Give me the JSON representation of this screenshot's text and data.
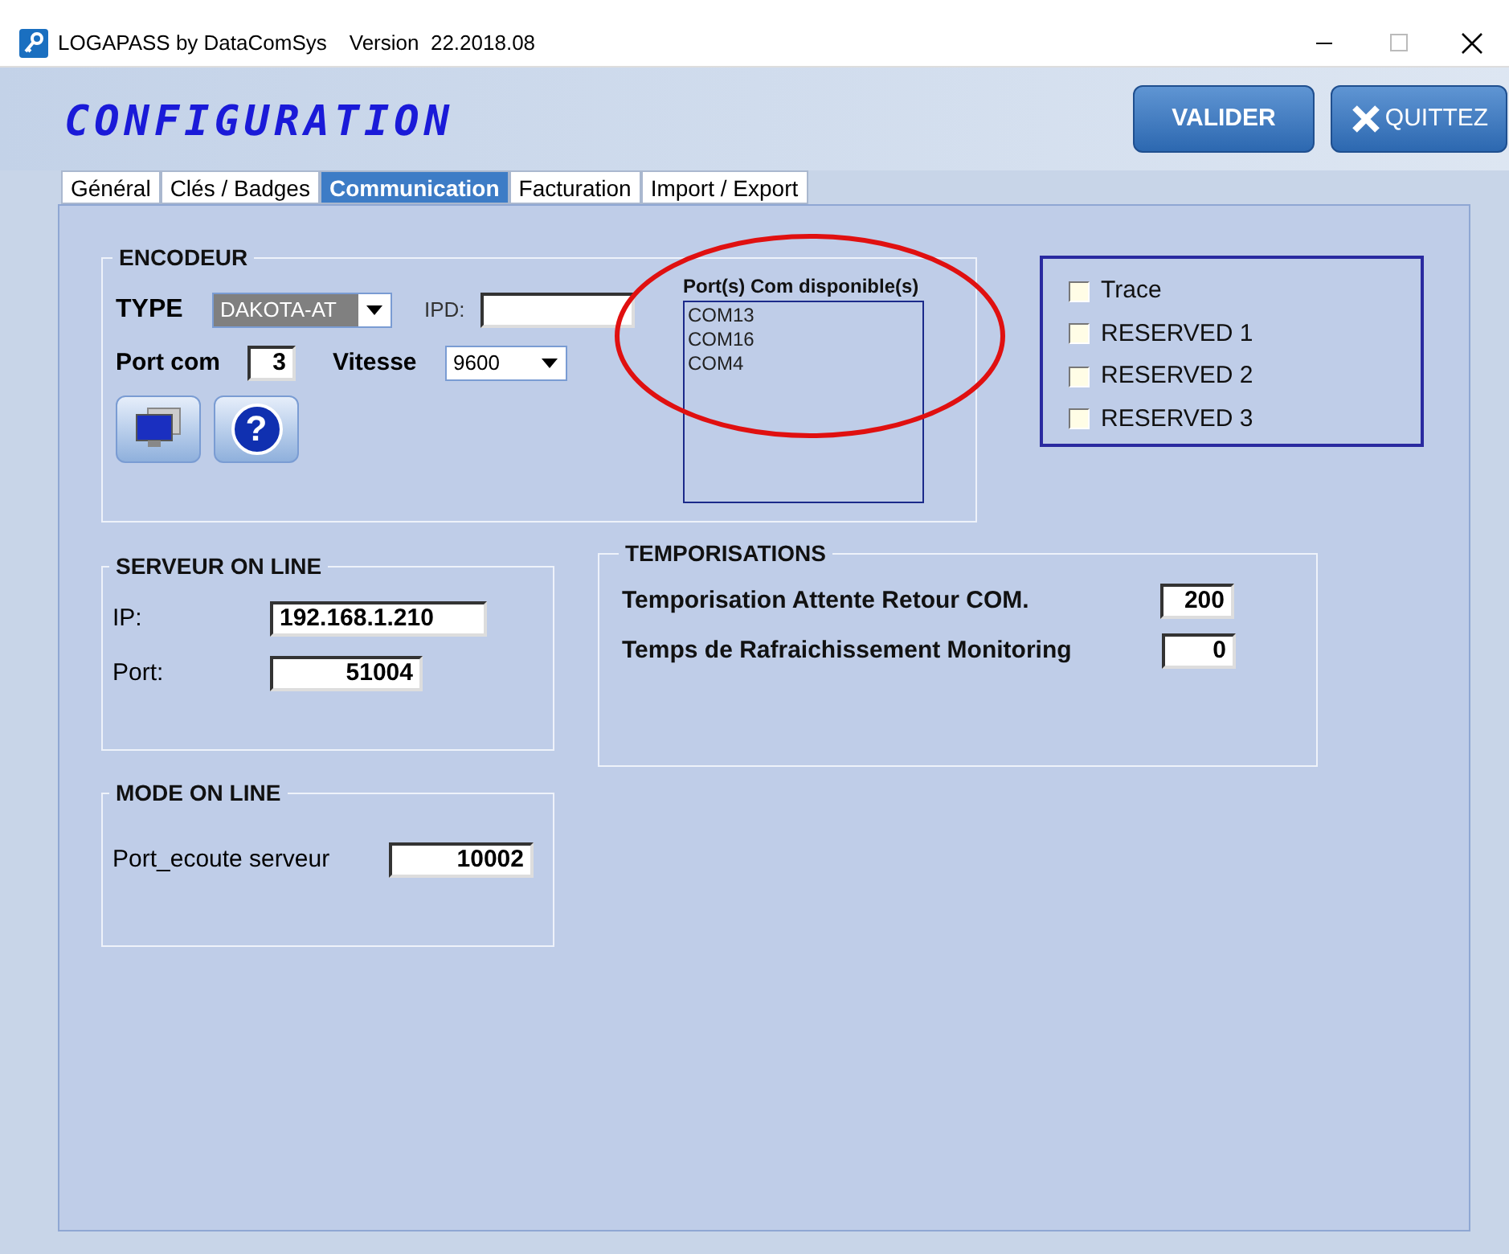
{
  "window": {
    "title": "LOGAPASS by DataComSys",
    "version": "Version  22.2018.08"
  },
  "header": {
    "title": "CONFIGURATION",
    "buttons": [
      {
        "label": "VALIDER",
        "kind": "plain"
      },
      {
        "label": "QUITTEZ",
        "kind": "close"
      }
    ]
  },
  "tabs": [
    {
      "label": "Général",
      "selected": false
    },
    {
      "label": "Clés / Badges",
      "selected": false
    },
    {
      "label": "Communication",
      "selected": true
    },
    {
      "label": "Facturation",
      "selected": false
    },
    {
      "label": "Import / Export",
      "selected": false
    }
  ],
  "encodeur": {
    "title": "ENCODEUR",
    "type_label": "TYPE",
    "type_value": "DAKOTA-AT",
    "ipd_label": "IPD:",
    "port_com_label": "Port com",
    "port_com_value": "3",
    "vitesse_label": "Vitesse",
    "vitesse_value": "9600",
    "ports_title": "Port(s) Com disponible(s)",
    "ports": [
      "COM13",
      "COM16",
      "COM4"
    ],
    "help_glyph": "?"
  },
  "options": [
    {
      "label": "Trace",
      "checked": false
    },
    {
      "label": "RESERVED 1",
      "checked": false
    },
    {
      "label": "RESERVED 2",
      "checked": false
    },
    {
      "label": "RESERVED 3",
      "checked": false
    }
  ],
  "serveur": {
    "title": "SERVEUR ON LINE",
    "fields": [
      {
        "label": "IP:",
        "value": "192.168.1.210"
      },
      {
        "label": "Port:",
        "value": "51004"
      }
    ]
  },
  "mode": {
    "title": "MODE ON LINE",
    "fields": [
      {
        "label": "Port_ecoute serveur",
        "value": "10002"
      }
    ]
  },
  "temporisations": {
    "title": "TEMPORISATIONS",
    "fields": [
      {
        "label": "Temporisation Attente Retour COM.",
        "value": "200"
      },
      {
        "label": "Temps de Rafraichissement Monitoring",
        "value": "0"
      }
    ]
  }
}
